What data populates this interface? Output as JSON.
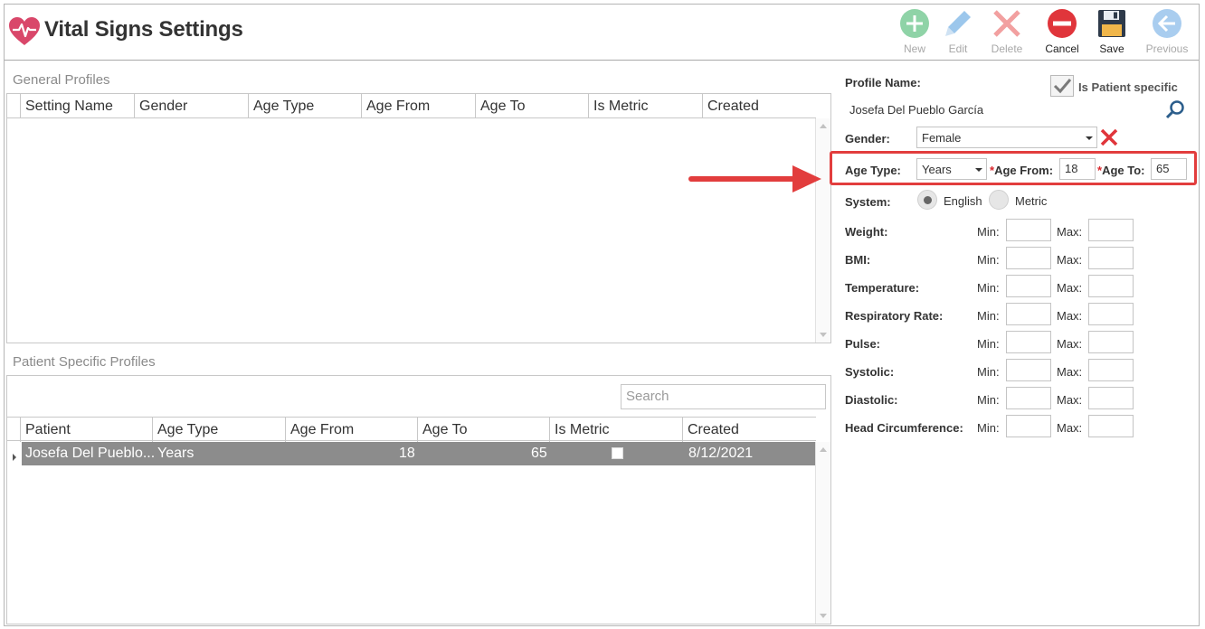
{
  "header": {
    "title": "Vital Signs Settings",
    "toolbar": [
      {
        "label": "New",
        "icon": "plus-circle-icon",
        "enabled": false,
        "color": "#8fd3a7"
      },
      {
        "label": "Edit",
        "icon": "pencil-icon",
        "enabled": false,
        "color": "#9cc7ec"
      },
      {
        "label": "Delete",
        "icon": "x-icon",
        "enabled": false,
        "color": "#f2a0a0"
      },
      {
        "label": "Cancel",
        "icon": "minus-circle-icon",
        "enabled": true,
        "color": "#e0353b"
      },
      {
        "label": "Save",
        "icon": "floppy-disk-icon",
        "enabled": true,
        "color": "#2e3a4a"
      },
      {
        "label": "Previous",
        "icon": "arrow-left-circle-icon",
        "enabled": false,
        "color": "#a9cdef"
      }
    ]
  },
  "general_profiles": {
    "title": "General Profiles",
    "columns": [
      "Setting Name",
      "Gender",
      "Age Type",
      "Age From",
      "Age To",
      "Is Metric",
      "Created"
    ],
    "rows": []
  },
  "patient_profiles": {
    "title": "Patient Specific Profiles",
    "search_placeholder": "Search",
    "columns": [
      "Patient",
      "Age Type",
      "Age From",
      "Age To",
      "Is Metric",
      "Created"
    ],
    "rows": [
      {
        "patient": "Josefa Del Pueblo...",
        "age_type": "Years",
        "age_from": "18",
        "age_to": "65",
        "is_metric": false,
        "created": "8/12/2021",
        "selected": true
      }
    ]
  },
  "form": {
    "profile_name_label": "Profile Name:",
    "is_patient_specific_label": "Is Patient specific",
    "is_patient_specific": true,
    "profile_name_value": "Josefa Del Pueblo García",
    "gender_label": "Gender:",
    "gender_value": "Female",
    "age_type_label": "Age Type:",
    "age_type_value": "Years",
    "required_mark": "*",
    "age_from_label": "Age From:",
    "age_from_value": "18",
    "age_to_label": "Age To:",
    "age_to_value": "65",
    "system_label": "System:",
    "system_options": [
      "English",
      "Metric"
    ],
    "system_selected": "English",
    "min_label": "Min:",
    "max_label": "Max:",
    "vitals": [
      "Weight:",
      "BMI:",
      "Temperature:",
      "Respiratory Rate:",
      "Pulse:",
      "Systolic:",
      "Diastolic:",
      "Head Circumference:"
    ]
  },
  "annotation": {
    "highlight_color": "#e23d3d",
    "arrow_color": "#e23d3d"
  }
}
